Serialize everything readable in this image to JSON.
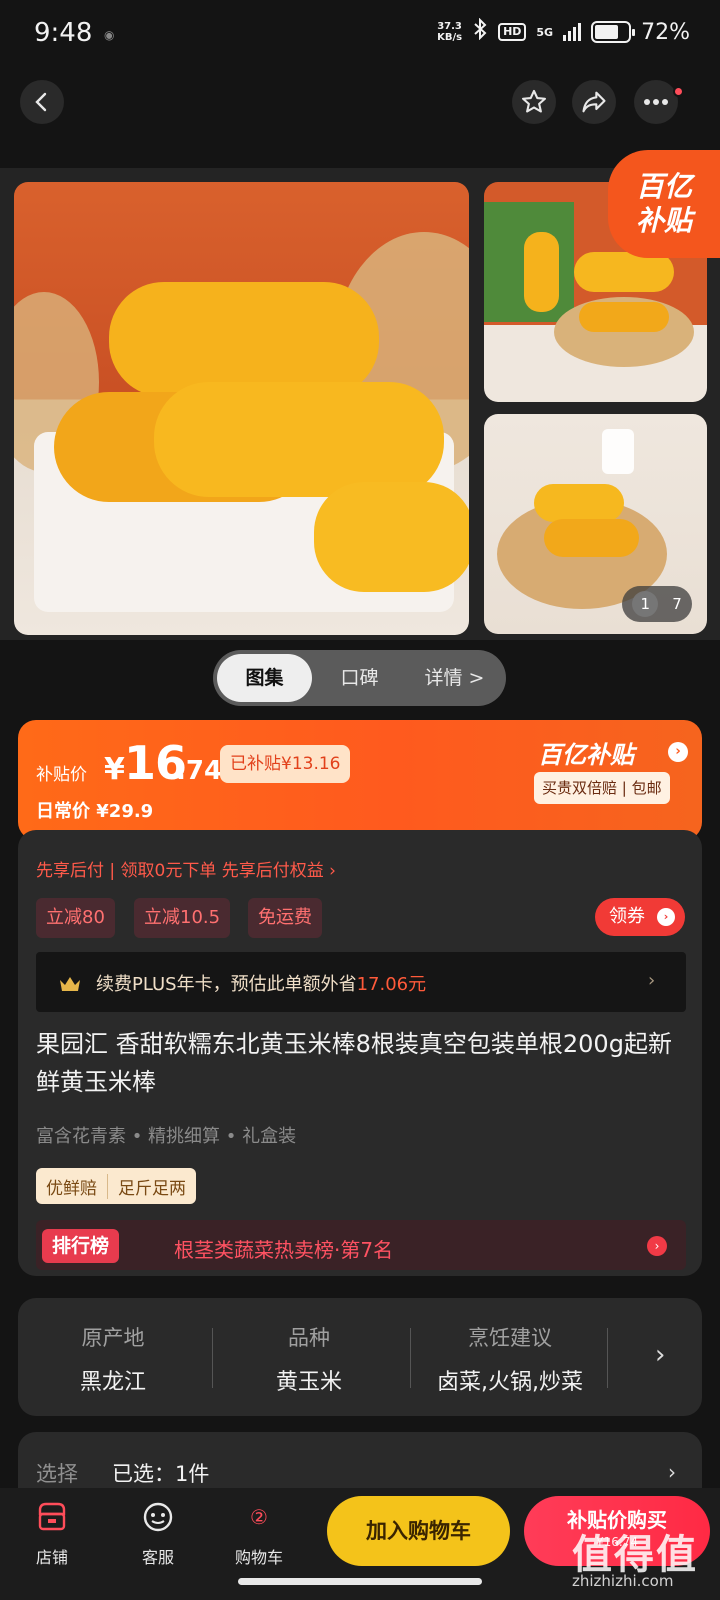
{
  "status_bar": {
    "time": "9:48",
    "net_speed_value": "37.3",
    "net_speed_unit": "KB/s",
    "hd": "HD",
    "network": "5G",
    "battery": "72%",
    "battery_level": 0.72
  },
  "gallery": {
    "subsidy_badge_line1": "百亿",
    "subsidy_badge_line2": "补贴",
    "page_current": "1",
    "page_total": "7"
  },
  "tabs": [
    {
      "label": "图集"
    },
    {
      "label": "口碑"
    },
    {
      "label": "详情 >"
    }
  ],
  "price": {
    "label": "补贴价",
    "currency": "¥",
    "integer": "16",
    "decimal": ".74",
    "subsidized": "已补贴¥13.16",
    "original_label": "日常价 ¥29.9",
    "brand": "百亿补贴",
    "brand_arrow": "›",
    "brand_tag": "买贵双倍赔 | 包邮"
  },
  "pay_later": "先享后付 | 领取0元下单 先享后付权益 ›",
  "coupons": [
    "立减80",
    "立减10.5",
    "免运费"
  ],
  "get_coupon": "领券",
  "plus": {
    "text_prefix": "续费PLUS年卡，预估此单额外省",
    "amount": "17.06元",
    "arrow": "›"
  },
  "product": {
    "title": "果园汇 香甜软糯东北黄玉米棒8根装真空包装单根200g起新鲜黄玉米棒",
    "features": "富含花青素 • 精挑细算 • 礼盒装",
    "tags": [
      "优鲜赔",
      "足斤足两"
    ]
  },
  "rank": {
    "badge": "排行榜",
    "text": "根茎类蔬菜热卖榜·第7名"
  },
  "specs": [
    {
      "key": "原产地",
      "value": "黑龙江"
    },
    {
      "key": "品种",
      "value": "黄玉米"
    },
    {
      "key": "烹饪建议",
      "value": "卤菜,火锅,炒菜"
    }
  ],
  "select": {
    "label": "选择",
    "value": "已选：1件"
  },
  "bottom_bar": {
    "store": "店铺",
    "service": "客服",
    "cart": "购物车",
    "cart_badge": "②",
    "add_to_cart": "加入购物车",
    "buy": "补贴价购买",
    "buy_sub": "¥16.74"
  },
  "watermark": {
    "text": "值得值",
    "url": "zhizhizhi.com"
  },
  "colors": {
    "accent": "#ff5a1e",
    "cart_button": "#f4c31a",
    "buy_button": "#ff2a44"
  }
}
